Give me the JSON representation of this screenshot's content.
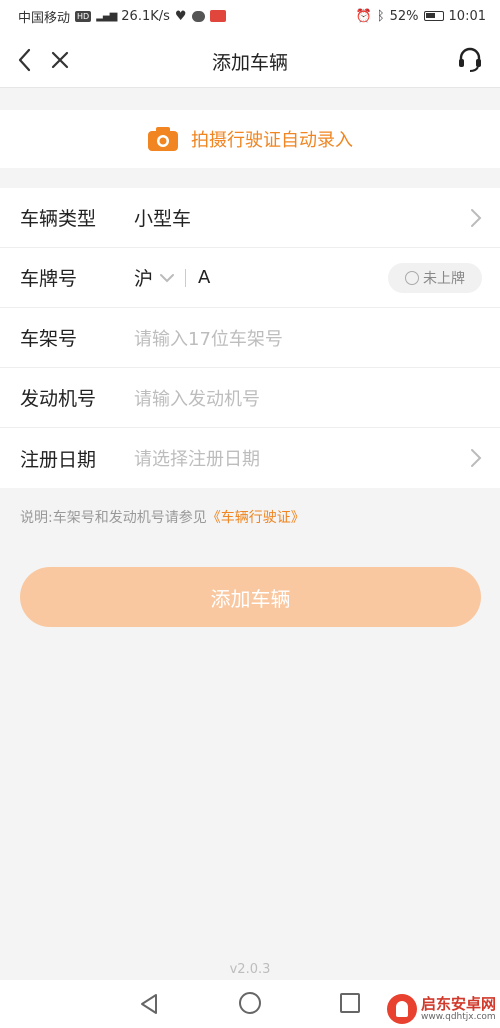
{
  "status_bar": {
    "carrier": "中国移动",
    "hd": "HD",
    "network": "4G",
    "speed": "26.1K/s",
    "battery": "52%",
    "time": "10:01"
  },
  "nav": {
    "title": "添加车辆"
  },
  "scan": {
    "label": "拍摄行驶证自动录入",
    "accent": "#f08521"
  },
  "form": {
    "vehicle_type": {
      "label": "车辆类型",
      "value": "小型车"
    },
    "plate": {
      "label": "车牌号",
      "province": "沪",
      "letter": "A",
      "unregistered_label": "未上牌"
    },
    "frame": {
      "label": "车架号",
      "placeholder": "请输入17位车架号"
    },
    "engine": {
      "label": "发动机号",
      "placeholder": "请输入发动机号"
    },
    "reg_date": {
      "label": "注册日期",
      "placeholder": "请选择注册日期"
    }
  },
  "note": {
    "text": "说明:车架号和发动机号请参见",
    "link": "《车辆行驶证》"
  },
  "submit": {
    "label": "添加车辆",
    "color": "#f9c8a0"
  },
  "version": "v2.0.3",
  "watermark": {
    "name": "启东安卓网",
    "url": "www.qdhtjx.com"
  }
}
